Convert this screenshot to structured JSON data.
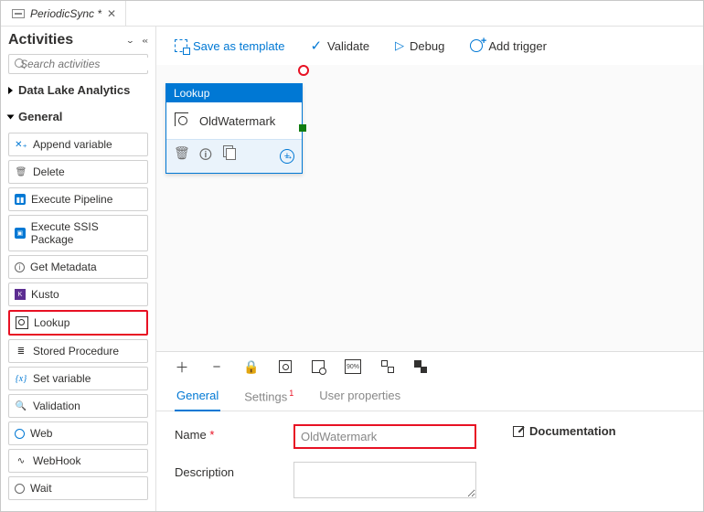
{
  "tab": {
    "title": "PeriodicSync *"
  },
  "sidebar": {
    "title": "Activities",
    "search_placeholder": "Search activities",
    "categories": {
      "dla": "Data Lake Analytics",
      "general": "General"
    },
    "items": [
      "Append variable",
      "Delete",
      "Execute Pipeline",
      "Execute SSIS Package",
      "Get Metadata",
      "Kusto",
      "Lookup",
      "Stored Procedure",
      "Set variable",
      "Validation",
      "Web",
      "WebHook",
      "Wait"
    ]
  },
  "toolbar": {
    "save": "Save as template",
    "validate": "Validate",
    "debug": "Debug",
    "trigger": "Add trigger"
  },
  "node": {
    "type": "Lookup",
    "name": "OldWatermark"
  },
  "props": {
    "tabs": {
      "general": "General",
      "settings": "Settings",
      "user": "User properties"
    },
    "name_label": "Name",
    "name_value": "OldWatermark",
    "desc_label": "Description",
    "doc": "Documentation",
    "pct": "90%"
  }
}
